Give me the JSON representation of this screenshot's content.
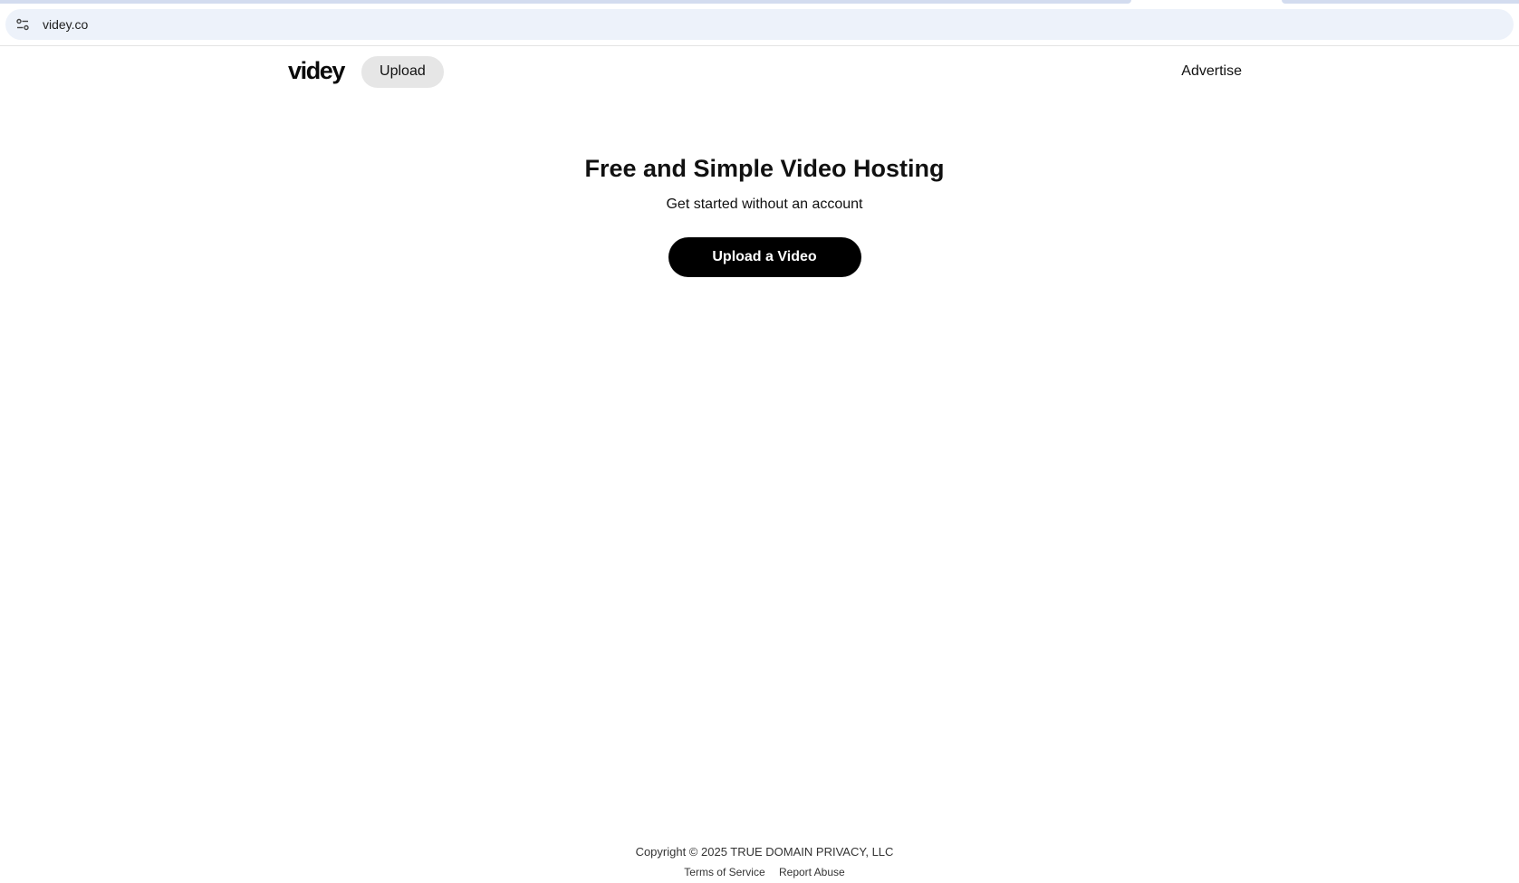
{
  "browser": {
    "url": "videy.co",
    "site_info_icon": "tune-icon"
  },
  "header": {
    "logo": "videy",
    "upload_label": "Upload",
    "advertise_label": "Advertise"
  },
  "hero": {
    "title": "Free and Simple Video Hosting",
    "subtitle": "Get started without an account",
    "cta_label": "Upload a Video"
  },
  "footer": {
    "copyright": "Copyright © 2025 TRUE DOMAIN PRIVACY, LLC",
    "links": [
      "Terms of Service",
      "Report Abuse"
    ]
  },
  "colors": {
    "cta_background": "#000000",
    "pill_background": "#e6e6e6",
    "address_bar": "#edf2fa"
  }
}
